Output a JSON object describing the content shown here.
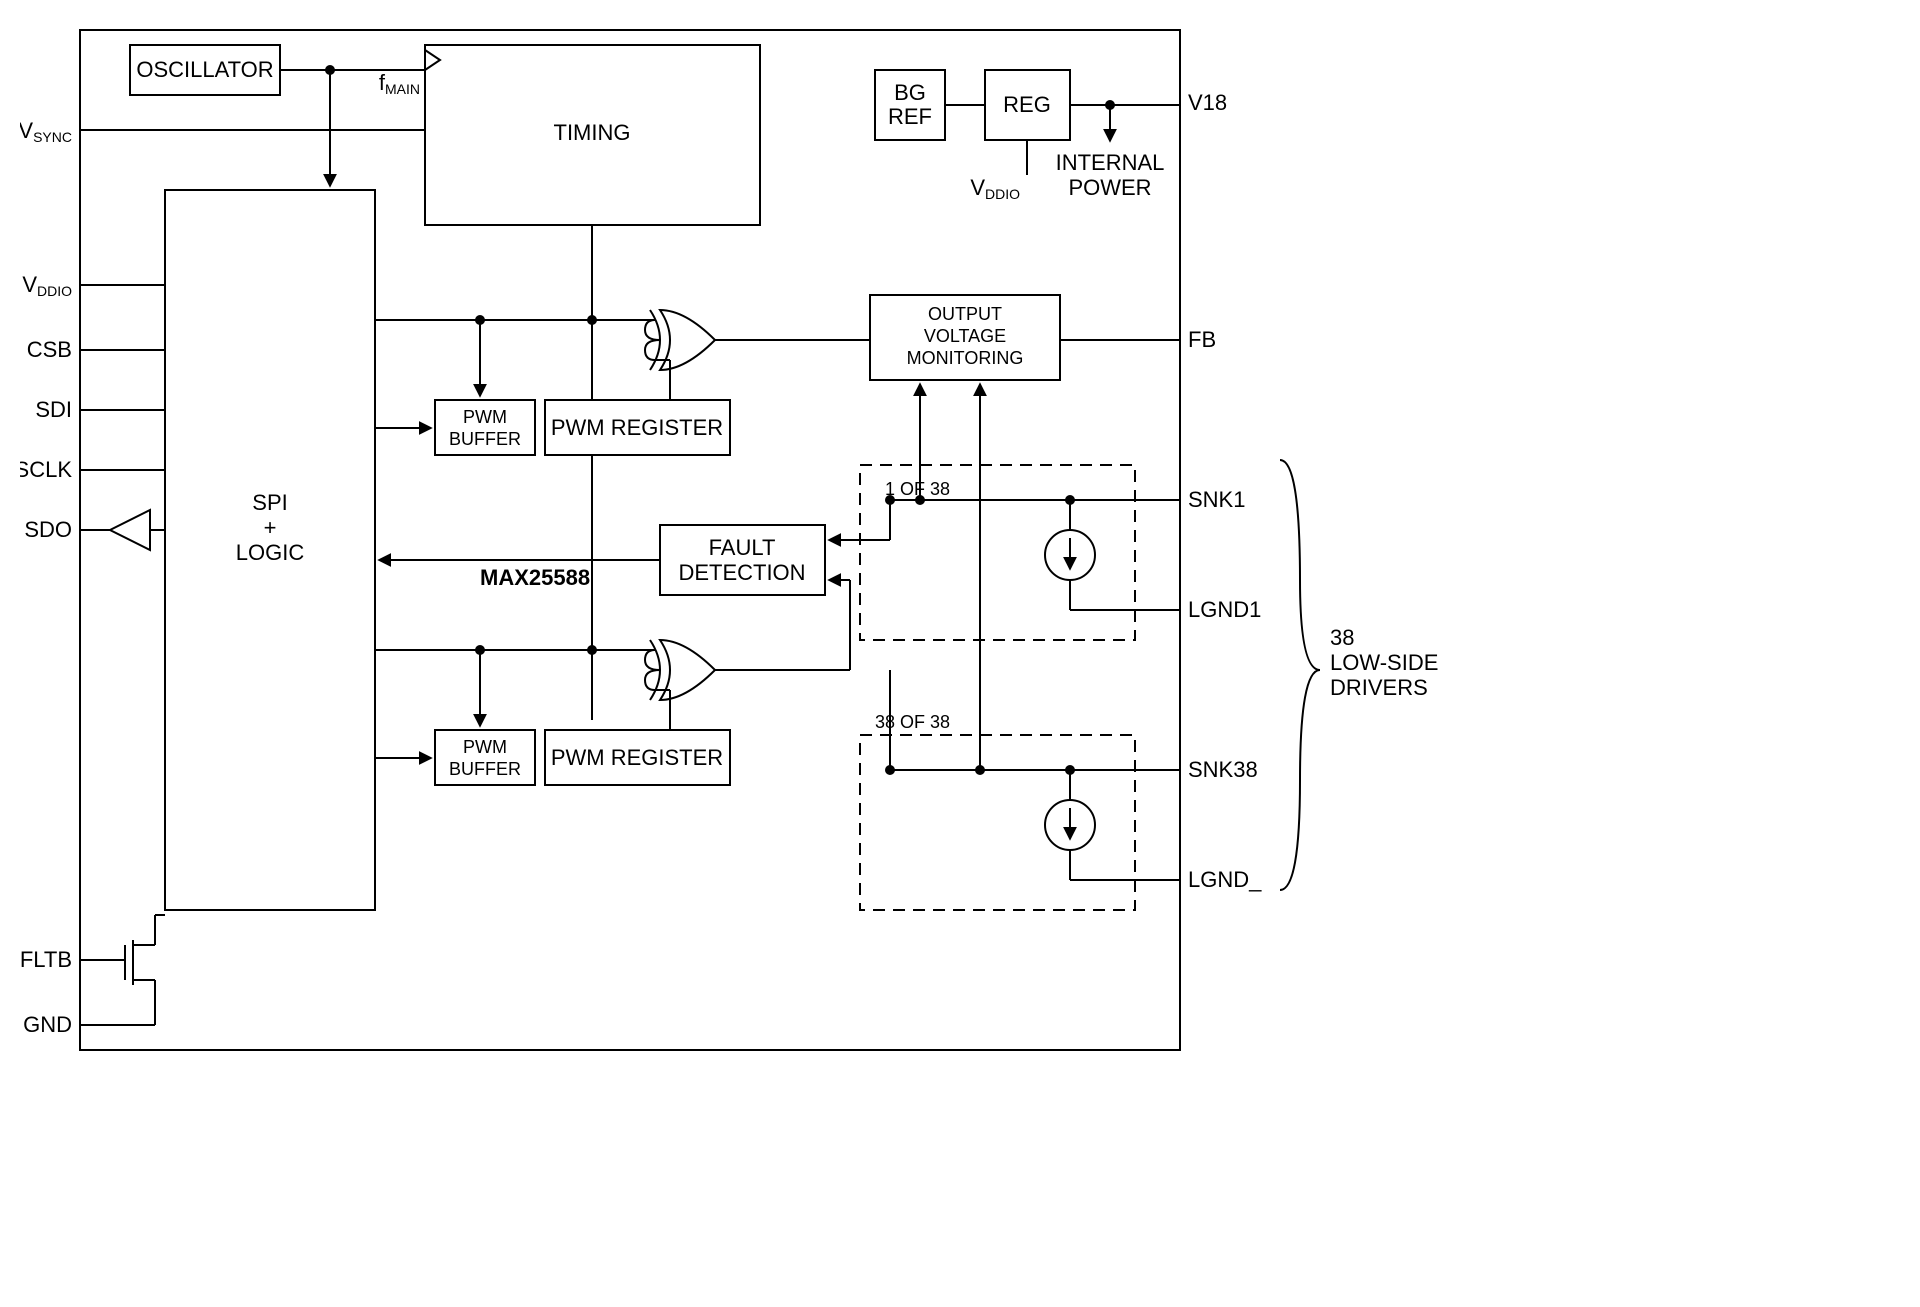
{
  "chip": "MAX25588",
  "blocks": {
    "osc": "OSCILLATOR",
    "timing": "TIMING",
    "fmain_pre": "f",
    "fmain_sub": "MAIN",
    "bgref_l1": "BG",
    "bgref_l2": "REF",
    "reg": "REG",
    "intpwr_l1": "INTERNAL",
    "intpwr_l2": "POWER",
    "spi_l1": "SPI",
    "spi_l2": "+",
    "spi_l3": "LOGIC",
    "pwmbuf_l1": "PWM",
    "pwmbuf_l2": "BUFFER",
    "pwmreg": "PWM REGISTER",
    "fault_l1": "FAULT",
    "fault_l2": "DETECTION",
    "ovm_l1": "OUTPUT",
    "ovm_l2": "VOLTAGE",
    "ovm_l3": "MONITORING",
    "drv1": "1 OF 38",
    "drv38": "38 OF 38",
    "drivers_l1": "38",
    "drivers_l2": "LOW-SIDE",
    "drivers_l3": "DRIVERS"
  },
  "pins": {
    "vsync_pre": "V",
    "vsync_sub": "SYNC",
    "vddio_pre": "V",
    "vddio_sub": "DDIO",
    "csb": "CSB",
    "sdi": "SDI",
    "sclk": "SCLK",
    "sdo": "SDO",
    "fltb": "FLTB",
    "gnd": "GND",
    "v18": "V18",
    "fb": "FB",
    "snk1": "SNK1",
    "lgnd1": "LGND1",
    "snk38": "SNK38",
    "lgnd_": "LGND_"
  }
}
